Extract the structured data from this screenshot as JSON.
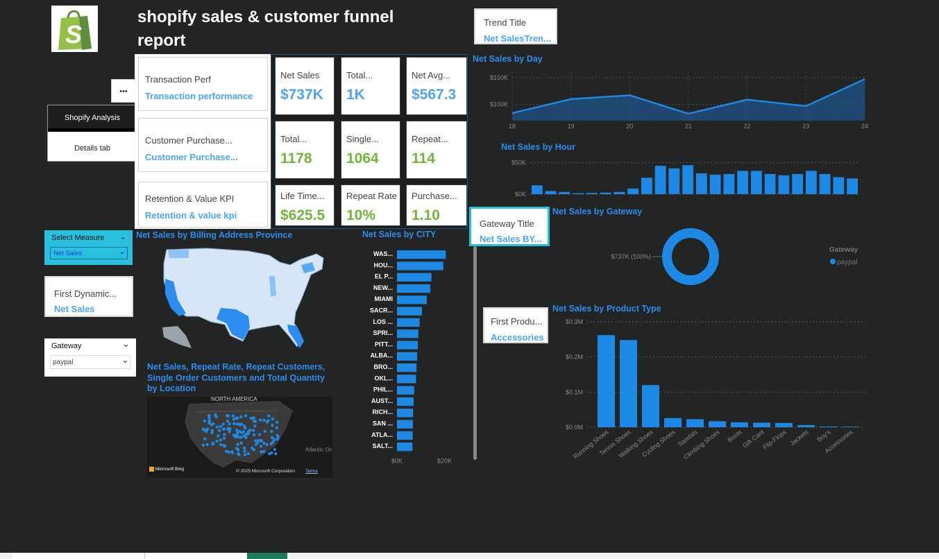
{
  "header": {
    "title_line1": "shopify sales & customer funnel",
    "title_line2": "report"
  },
  "nav": {
    "more": "•••",
    "tab_active": "Shopify Analysis",
    "tab_other": "Details tab"
  },
  "trend_card": {
    "label": "Trend Title",
    "value": "Net SalesTren..."
  },
  "gateway_card": {
    "label": "Gateway Title",
    "value": "Net Sales BY..."
  },
  "dynamic_card": {
    "label": "First Dynamic...",
    "value": "Net Sales"
  },
  "product_card": {
    "label": "First Produ...",
    "value": "Accessories"
  },
  "sections": [
    {
      "label": "Transaction Perf",
      "value": "Transaction performance"
    },
    {
      "label": "Customer Purchase...",
      "value": "Customer Purchase..."
    },
    {
      "label": "Retention & Value KPI",
      "value": "Retention & value kpi"
    }
  ],
  "kpis": [
    {
      "label": "Net Sales",
      "value": "$737K",
      "color": "#4fa3f2"
    },
    {
      "label": "Total...",
      "value": "1K",
      "color": "#4fa3f2"
    },
    {
      "label": "Net Avg...",
      "value": "$567.3",
      "color": "#4fa3f2"
    },
    {
      "label": "Total...",
      "value": "1178",
      "color": "#72b43e"
    },
    {
      "label": "Single...",
      "value": "1064",
      "color": "#72b43e"
    },
    {
      "label": "Repeat...",
      "value": "114",
      "color": "#72b43e"
    },
    {
      "label": "Life Time...",
      "value": "$625.5",
      "color": "#72b43e"
    },
    {
      "label": "Repeat Rate",
      "value": "10%",
      "color": "#72b43e"
    },
    {
      "label": "Purchase...",
      "value": "1.10",
      "color": "#72b43e"
    }
  ],
  "slicers": {
    "measure": {
      "label": "Select Measure",
      "value": "Net Sales"
    },
    "gateway": {
      "label": "Gateway",
      "value": "paypal"
    }
  },
  "map_titles": {
    "province": "Net Sales by Billing Address Province",
    "location_line1": "Net Sales, Repeat Rate, Repeat Customers,",
    "location_line2": "Single Order Customers and Total Quantity",
    "location_line3": "by Location",
    "north_america": "NORTH AMERICA",
    "ocean": "Atlantic Oc",
    "bing": "Microsoft Bing",
    "copyright": "© 2025 Microsoft Corporation",
    "terms": "Terms"
  },
  "colors": {
    "accent": "#1e88e5",
    "kpi_blue": "#4fa3f2",
    "kpi_green": "#72b43e",
    "title_blue": "#2d8cf0",
    "bg": "#222523",
    "slicer": "#29c0e0"
  },
  "chart_data": [
    {
      "id": "day",
      "type": "area",
      "title": "Net Sales by Day",
      "x": [
        18,
        19,
        20,
        21,
        22,
        23,
        24
      ],
      "values": [
        84000,
        110000,
        117000,
        83000,
        109000,
        97000,
        147000
      ],
      "yticks": [
        {
          "v": 100000,
          "label": "$100K"
        },
        {
          "v": 150000,
          "label": "$150K"
        }
      ],
      "ylim": [
        70000,
        160000
      ],
      "grid": true
    },
    {
      "id": "hour",
      "type": "bar",
      "title": "Net Sales by Hour",
      "values": [
        14000,
        5000,
        3500,
        1500,
        2000,
        2500,
        3500,
        9000,
        26000,
        45000,
        41000,
        46000,
        33000,
        31000,
        32000,
        37000,
        37000,
        32000,
        30000,
        32000,
        37000,
        32000,
        27000,
        25000
      ],
      "yticks": [
        {
          "v": 0,
          "label": "$0K"
        },
        {
          "v": 50000,
          "label": "$50K"
        }
      ],
      "ylim": [
        0,
        55000
      ],
      "grid": true
    },
    {
      "id": "city",
      "type": "bar",
      "title": "Net Sales by CITY",
      "categories": [
        "WAS...",
        "HOU...",
        "EL P...",
        "NEW...",
        "MIAMI",
        "SACR...",
        "LOS ...",
        "SPRI...",
        "PITT...",
        "ALBA...",
        "BRO...",
        "OKL...",
        "PHIL...",
        "AUST...",
        "RICH...",
        "SAN ...",
        "ATLA...",
        "SALT..."
      ],
      "values": [
        20500,
        19500,
        14500,
        14000,
        12500,
        10500,
        9500,
        9000,
        8800,
        8500,
        8200,
        8000,
        7200,
        7000,
        6800,
        6700,
        6600,
        6500
      ],
      "xticks": [
        {
          "v": 0,
          "label": "$0K"
        },
        {
          "v": 20000,
          "label": "$20K"
        }
      ],
      "xlim": [
        0,
        21000
      ]
    },
    {
      "id": "gateway",
      "type": "pie",
      "title": "Net Sales by Gateway",
      "slices": [
        {
          "label": "paypal",
          "value": 737000,
          "text": "$737K (100%)"
        }
      ],
      "legend_title": "Gateway",
      "legend": [
        "paypal"
      ]
    },
    {
      "id": "product",
      "type": "bar",
      "title": "Net Sales by Product Type",
      "categories": [
        "Running Shoes",
        "Tennis Shoes",
        "Walking Shoes",
        "Cycling Shoes",
        "Sandals",
        "Climbing Shoes",
        "Boots",
        "Gift Card",
        "Flip-Flops",
        "Jackets",
        "Boy's",
        "Accessories"
      ],
      "values": [
        262000,
        248000,
        120000,
        26000,
        23000,
        17000,
        14000,
        13000,
        12000,
        6000,
        2000,
        1500
      ],
      "yticks": [
        {
          "v": 0,
          "label": "$0.0M"
        },
        {
          "v": 100000,
          "label": "$0.1M"
        },
        {
          "v": 200000,
          "label": "$0.2M"
        },
        {
          "v": 300000,
          "label": "$0.3M"
        }
      ],
      "ylim": [
        0,
        300000
      ],
      "grid": true
    }
  ]
}
